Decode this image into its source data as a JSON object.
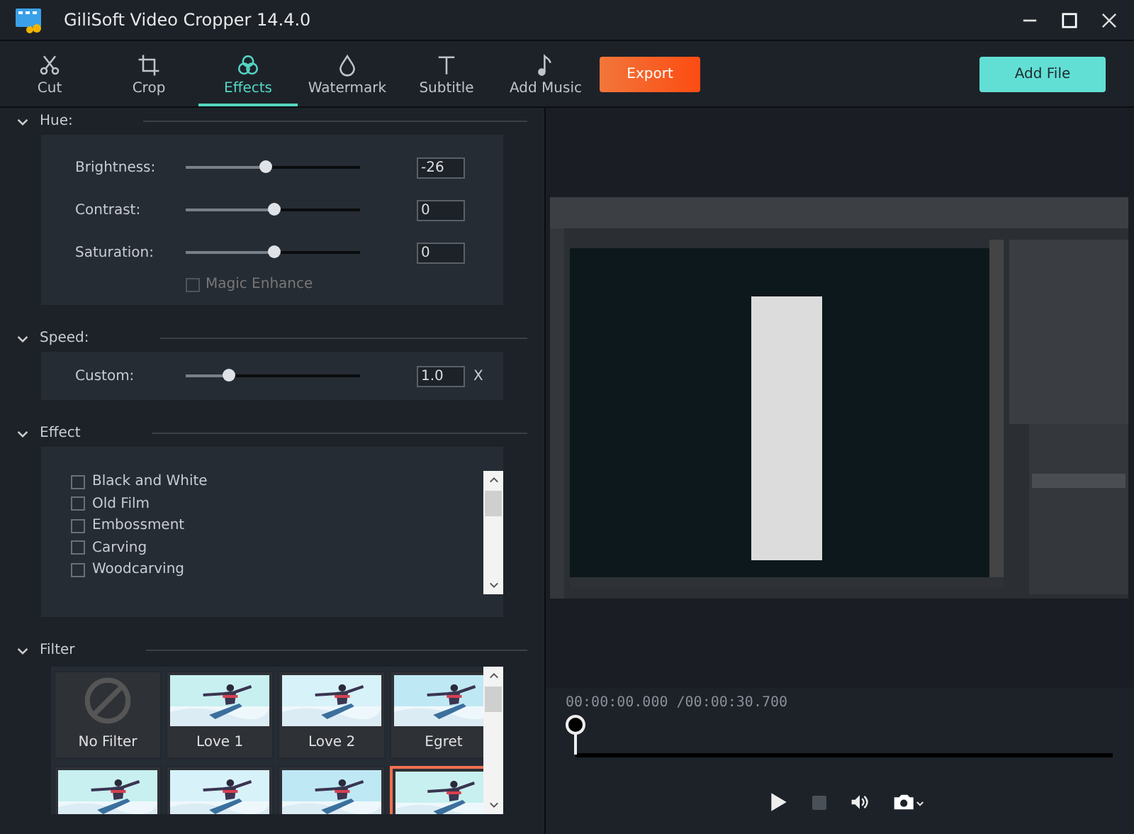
{
  "window": {
    "title": "GiliSoft Video Cropper 14.4.0"
  },
  "tabs": [
    {
      "label": "Cut",
      "selected": false
    },
    {
      "label": "Crop",
      "selected": false
    },
    {
      "label": "Effects",
      "selected": true
    },
    {
      "label": "Watermark",
      "selected": false
    },
    {
      "label": "Subtitle",
      "selected": false
    },
    {
      "label": "Add Music",
      "selected": false
    }
  ],
  "export_button": "Export",
  "add_file_button": "Add File",
  "hue": {
    "title": "Hue:",
    "sliders": [
      {
        "label": "Brightness:",
        "level": 0.455,
        "value": "-26"
      },
      {
        "label": "Contrast:",
        "level": 0.5,
        "value": "0"
      },
      {
        "label": "Saturation:",
        "level": 0.5,
        "value": "0"
      }
    ],
    "magic_enhance": {
      "label": "Magic Enhance",
      "checked": false,
      "disabled": true
    }
  },
  "speed": {
    "title": "Speed:",
    "label": "Custom:",
    "level": 0.245,
    "value": "1.0",
    "unit": "X"
  },
  "effect": {
    "title": "Effect",
    "items": [
      {
        "label": "Black and White",
        "checked": false
      },
      {
        "label": "Old Film",
        "checked": false
      },
      {
        "label": "Embossment",
        "checked": false
      },
      {
        "label": "Carving",
        "checked": false
      },
      {
        "label": "Woodcarving",
        "checked": false
      }
    ]
  },
  "filter": {
    "title": "Filter",
    "items": [
      {
        "kind": "none",
        "label": "No Filter",
        "selected": false
      },
      {
        "kind": "picture",
        "label": "Love 1",
        "selected": false
      },
      {
        "kind": "picture",
        "label": "Love 2",
        "selected": false
      },
      {
        "kind": "picture",
        "label": "Egret",
        "selected": false
      },
      {
        "kind": "picture",
        "selected": false
      },
      {
        "kind": "picture",
        "selected": false
      },
      {
        "kind": "picture",
        "selected": false
      },
      {
        "kind": "picture",
        "selected": true
      }
    ]
  },
  "player": {
    "time": "00:00:00.000 /00:00:30.700",
    "level": 0
  }
}
